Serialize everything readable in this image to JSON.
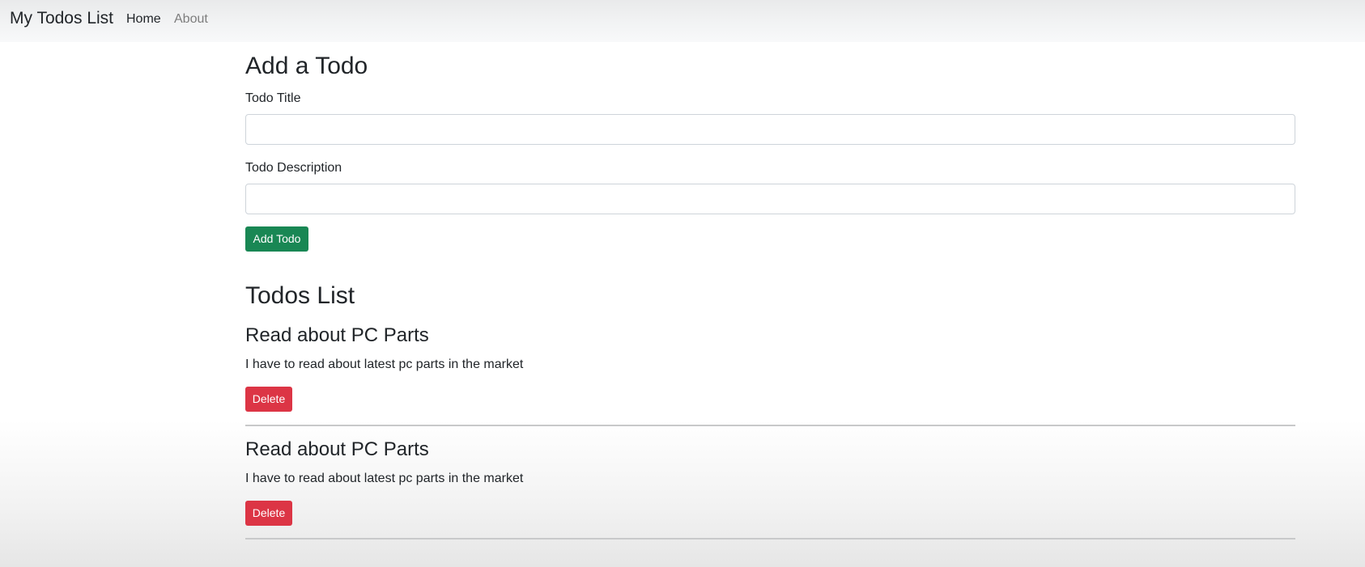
{
  "navbar": {
    "brand": "My Todos List",
    "links": [
      {
        "label": "Home",
        "active": true
      },
      {
        "label": "About",
        "active": false
      }
    ]
  },
  "form": {
    "heading": "Add a Todo",
    "title_label": "Todo Title",
    "title_value": "",
    "description_label": "Todo Description",
    "description_value": "",
    "submit_label": "Add Todo"
  },
  "list": {
    "heading": "Todos List",
    "items": [
      {
        "title": "Read about PC Parts",
        "description": "I have to read about latest pc parts in the market",
        "delete_label": "Delete"
      },
      {
        "title": "Read about PC Parts",
        "description": "I have to read about latest pc parts in the market",
        "delete_label": "Delete"
      }
    ]
  },
  "colors": {
    "success": "#198754",
    "danger": "#dc3545",
    "navbar_bg": "#f8f9fa"
  }
}
